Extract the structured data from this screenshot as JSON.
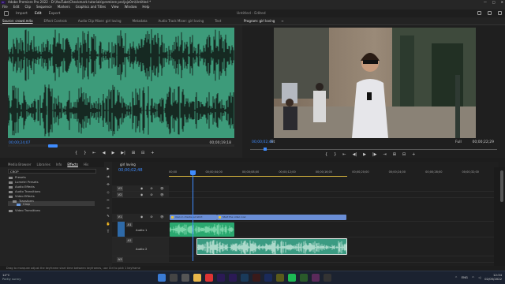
{
  "app": {
    "logo_text": "Pr",
    "title": "Adobe Premiere Pro 2022 - D:\\YouTube\\Checkmark tutorials\\premiere pro\\jojo0m\\Untitled *"
  },
  "window_controls": [
    "—",
    "□",
    "✕"
  ],
  "menu": [
    "File",
    "Edit",
    "Clip",
    "Sequence",
    "Markers",
    "Graphics and Titles",
    "View",
    "Window",
    "Help"
  ],
  "workspace": {
    "tabs": [
      "Import",
      "Edit",
      "Export"
    ],
    "active": "Edit",
    "center_text": "Untitled - Edited"
  },
  "source_panel": {
    "tabs": [
      "Source: crowd.m4a",
      "Effect Controls",
      "Audio Clip Mixer: girl loving",
      "Metadata",
      "Audio Track Mixer: girl loving",
      "Text"
    ],
    "current_time": "00;00;24;07",
    "duration": "00;00;19;18",
    "controls": [
      "{",
      "}",
      "⇤",
      "◀",
      "▶",
      "▶|",
      "⊞",
      "⊟",
      "+"
    ]
  },
  "program_panel": {
    "tabs": [
      "Program: girl loving",
      "≡"
    ],
    "current_time": "00;00;02;48",
    "fit": "Fit",
    "quality": "Full",
    "duration": "00;00;22;29",
    "controls": [
      "{",
      "}",
      "⇤",
      "◀|",
      "▶",
      "|▶",
      "⇥",
      "⊞",
      "⊟",
      "+"
    ]
  },
  "project_panel": {
    "tabs": [
      "Media Browser",
      "Libraries",
      "Info",
      "Effects",
      "His"
    ],
    "active_tab": "Effects",
    "search_value": "CROP",
    "tree": [
      {
        "label": "Presets",
        "indent": 0
      },
      {
        "label": "Lumetri Presets",
        "indent": 0
      },
      {
        "label": "Audio Effects",
        "indent": 0
      },
      {
        "label": "Audio Transitions",
        "indent": 0
      },
      {
        "label": "Video Effects",
        "indent": 0
      },
      {
        "label": "Transform",
        "indent": 1
      },
      {
        "label": "Crop",
        "indent": 2
      },
      {
        "label": "Video Transitions",
        "indent": 0
      }
    ]
  },
  "tools": [
    "▶",
    "⇉",
    "✣",
    "◇",
    "✂",
    "↔",
    "✎",
    "✋",
    "T"
  ],
  "timeline": {
    "tab": "girl loving",
    "current_time": "00;00;02;48",
    "ruler": [
      "00;00",
      "00;00;04;00",
      "00;00;08;00",
      "00;00;12;00",
      "00;00;16;00",
      "00;00;20;00",
      "00;00;24;00",
      "00;00;28;00",
      "00;00;32;00"
    ],
    "tracks": [
      {
        "tag": "V3",
        "name": "",
        "icons": "◉ ⊘ 👁"
      },
      {
        "tag": "V2",
        "name": "",
        "icons": "◉ ⊘ 👁"
      },
      {
        "tag": "V1",
        "name": "",
        "icons": "◉ ⊘ 👁"
      },
      {
        "tag": "A1",
        "name": "Audio 1",
        "icons": "M S 🎤"
      },
      {
        "tag": "A2",
        "name": "Audio 2",
        "icons": "M S 🎤"
      },
      {
        "tag": "A3",
        "name": "",
        "icons": "M S 🎤"
      }
    ],
    "clips": {
      "v1_a": "man in checkered shirt",
      "v1_b": "Start the video now"
    }
  },
  "status_text": "Drag to marquee adjust the keyframe start time between keyframes, use Ctrl to pick 1 keyframe",
  "taskbar": {
    "weather_temp": "14°C",
    "weather_desc": "Partly sunny",
    "lang": "ENG",
    "time": "12:34",
    "date": "02/05/2022"
  },
  "colors": {
    "accent": "#3f8cff",
    "audio_wave": "#3d9b7a",
    "video_clip": "#6a8ed6",
    "work_area": "#d6b33d"
  }
}
